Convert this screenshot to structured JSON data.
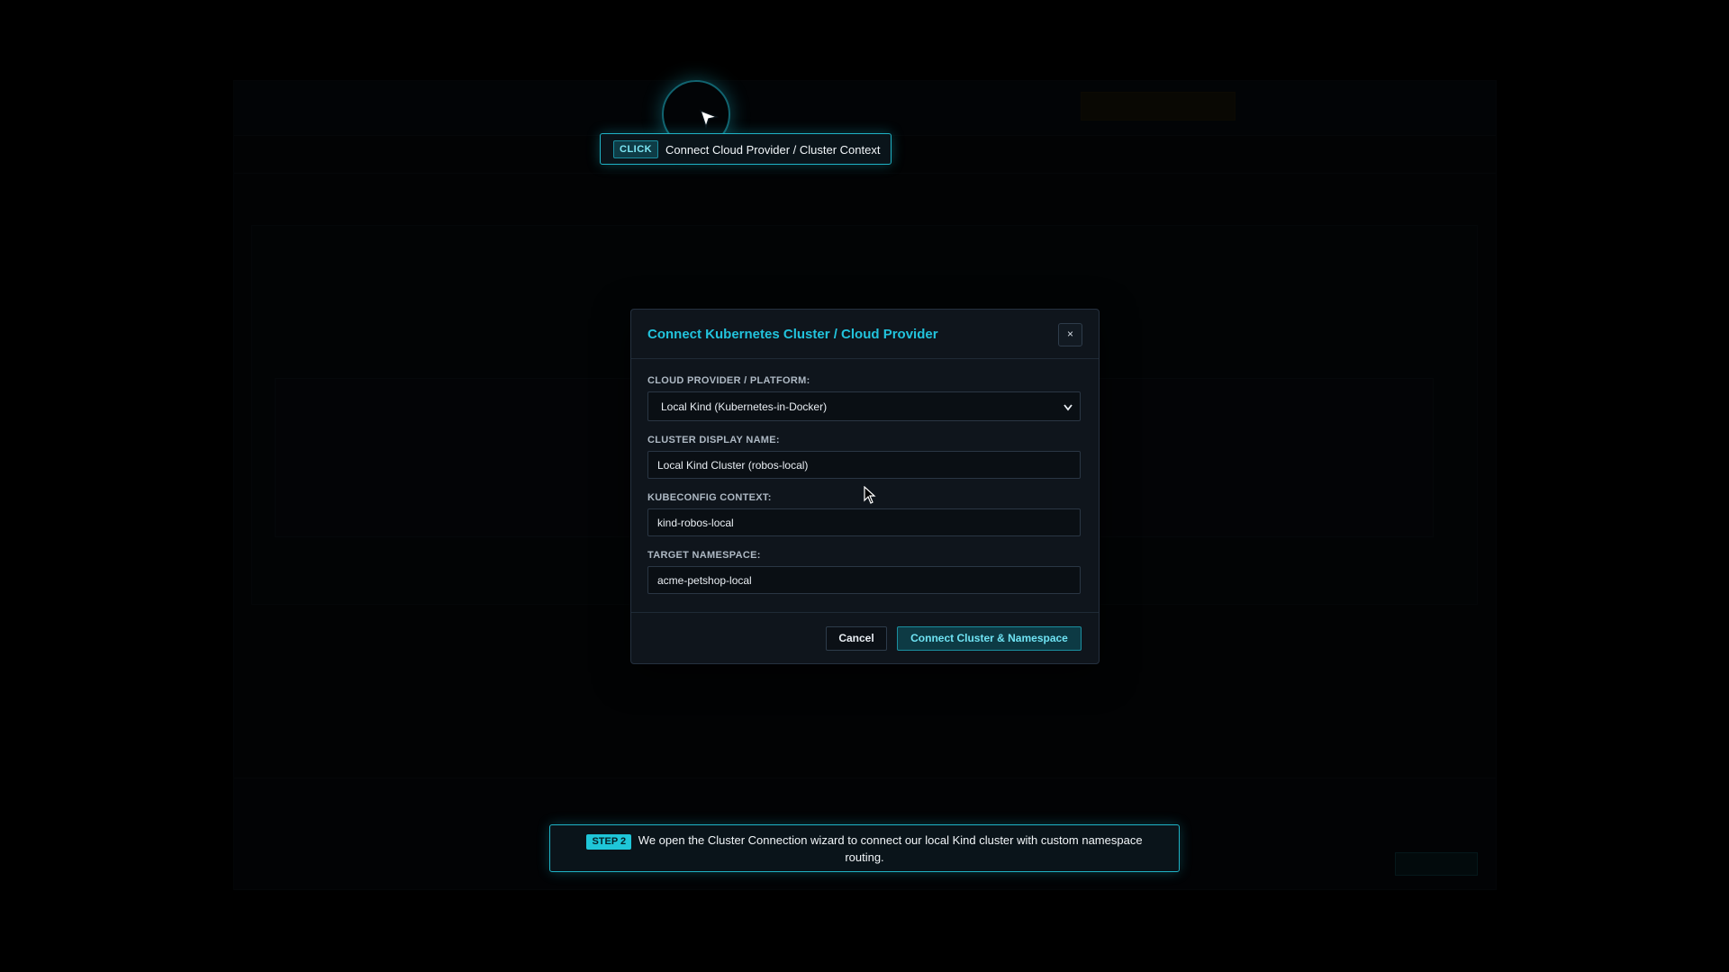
{
  "tooltip": {
    "badge": "CLICK",
    "text": "Connect Cloud Provider / Cluster Context"
  },
  "modal": {
    "title": "Connect Kubernetes Cluster / Cloud Provider",
    "close_label": "×",
    "fields": {
      "provider_label": "CLOUD PROVIDER / PLATFORM:",
      "provider_value": "Local Kind (Kubernetes-in-Docker)",
      "cluster_name_label": "CLUSTER DISPLAY NAME:",
      "cluster_name_value": "Local Kind Cluster (robos-local)",
      "kubeconfig_label": "KUBECONFIG CONTEXT:",
      "kubeconfig_value": "kind-robos-local",
      "namespace_label": "TARGET NAMESPACE:",
      "namespace_value": "acme-petshop-local"
    },
    "buttons": {
      "cancel": "Cancel",
      "connect": "Connect Cluster & Namespace"
    }
  },
  "step_banner": {
    "badge": "STEP 2",
    "text": "We open the Cluster Connection wizard to connect our local Kind cluster with custom namespace routing."
  },
  "icons": {
    "close": "close-icon",
    "chevron": "chevron-down-icon",
    "pointer": "pointer-arrow-icon",
    "cursor": "mouse-cursor-icon"
  },
  "colors": {
    "accent": "#1fc6d8",
    "modal_bg": "#0f151c",
    "backdrop": "#000000"
  }
}
